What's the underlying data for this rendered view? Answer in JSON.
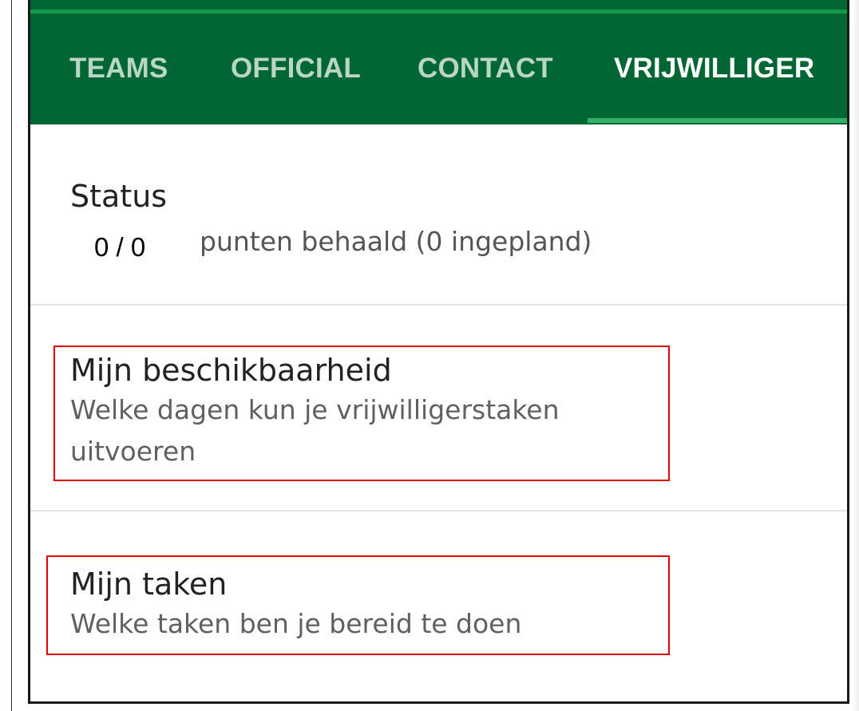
{
  "tabs": [
    {
      "label": "TEAMS",
      "active": false
    },
    {
      "label": "OFFICIAL",
      "active": false
    },
    {
      "label": "CONTACT",
      "active": false
    },
    {
      "label": "VRIJWILLIGER",
      "active": true
    }
  ],
  "status": {
    "title": "Status",
    "score": "0 / 0",
    "text": "punten behaald (0 ingepland)"
  },
  "menu": {
    "beschikbaarheid": {
      "title": "Mijn beschikbaarheid",
      "desc_line1": "Welke dagen kun je vrijwilligerstaken",
      "desc_line2": "uitvoeren"
    },
    "taken": {
      "title": "Mijn taken",
      "desc": "Welke taken ben je bereid te doen"
    }
  },
  "colors": {
    "header_green": "#006633",
    "active_indicator": "#33b067",
    "highlight_red": "#e00000"
  }
}
